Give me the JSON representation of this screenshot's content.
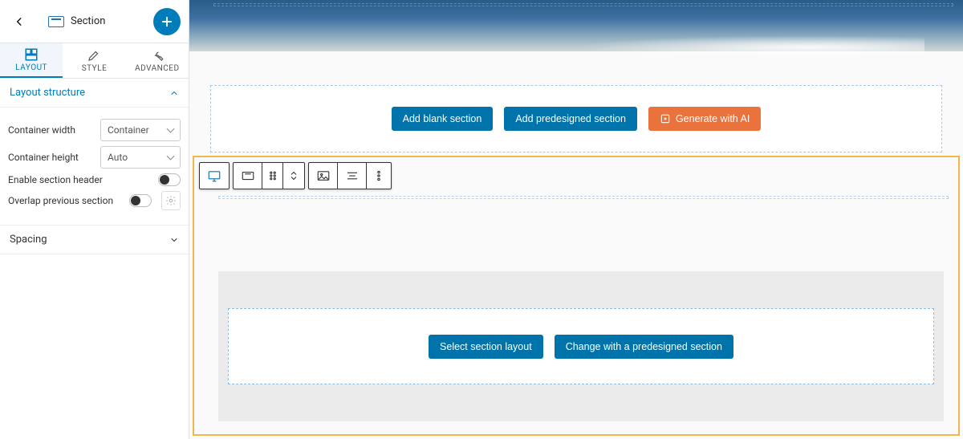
{
  "sidebar": {
    "title": "Section",
    "tabs": {
      "layout": "LAYOUT",
      "style": "STYLE",
      "advanced": "ADVANCED"
    },
    "panels": {
      "layout_structure": {
        "title": "Layout structure",
        "container_width_label": "Container width",
        "container_width_value": "Container",
        "container_height_label": "Container height",
        "container_height_value": "Auto",
        "enable_header_label": "Enable section header",
        "overlap_label": "Overlap previous section"
      },
      "spacing": {
        "title": "Spacing"
      }
    }
  },
  "canvas": {
    "add_blank": "Add blank section",
    "add_predesigned": "Add predesigned section",
    "generate_ai": "Generate with AI",
    "select_layout": "Select section layout",
    "change_predesigned": "Change with a predesigned section"
  }
}
